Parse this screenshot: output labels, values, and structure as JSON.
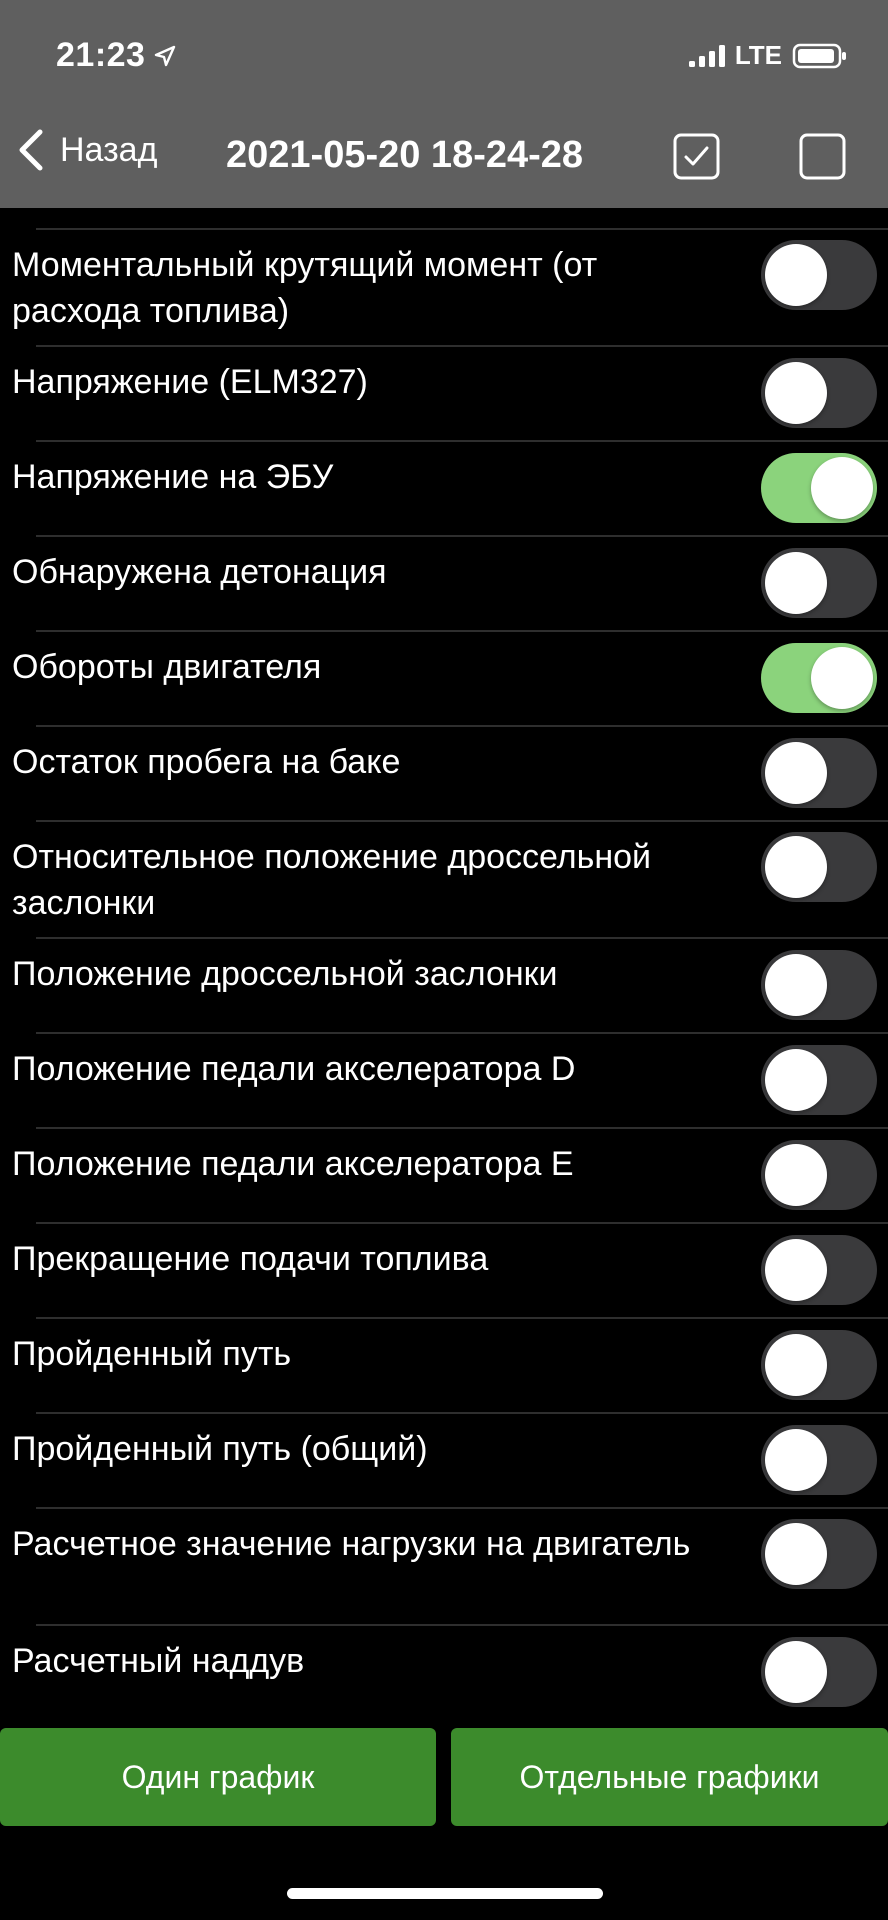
{
  "status_bar": {
    "time": "21:23",
    "network": "LTE",
    "icons": [
      "location-arrow-icon",
      "signal-icon",
      "battery-icon"
    ]
  },
  "nav": {
    "back_label": "Назад",
    "title": "2021-05-20 18-24-28",
    "icons": [
      "chevron-left-icon",
      "checkbox-checked-icon",
      "checkbox-empty-icon"
    ]
  },
  "items": [
    {
      "label": "Моментальный крутящий момент (от расхода топлива)",
      "on": false
    },
    {
      "label": "Напряжение (ELM327)",
      "on": false
    },
    {
      "label": "Напряжение на ЭБУ",
      "on": true
    },
    {
      "label": "Обнаружена детонация",
      "on": false
    },
    {
      "label": "Обороты двигателя",
      "on": true
    },
    {
      "label": "Остаток пробега на баке",
      "on": false
    },
    {
      "label": "Относительное положение дроссельной заслонки",
      "on": false
    },
    {
      "label": "Положение дроссельной заслонки",
      "on": false
    },
    {
      "label": "Положение педали акселератора D",
      "on": false
    },
    {
      "label": "Положение педали акселератора E",
      "on": false
    },
    {
      "label": "Прекращение подачи топлива",
      "on": false
    },
    {
      "label": "Пройденный путь",
      "on": false
    },
    {
      "label": "Пройденный путь (общий)",
      "on": false
    },
    {
      "label": "Расчетное значение нагрузки на двигатель",
      "on": false
    },
    {
      "label": "Расчетный наддув",
      "on": false
    }
  ],
  "buttons": {
    "one_chart": "Один график",
    "separate_charts": "Отдельные графики"
  },
  "colors": {
    "header_bg": "#5f5f5f",
    "toggle_on": "#8bd37c",
    "toggle_off": "#3a3a3c",
    "button_bg": "#3c8b2c"
  }
}
